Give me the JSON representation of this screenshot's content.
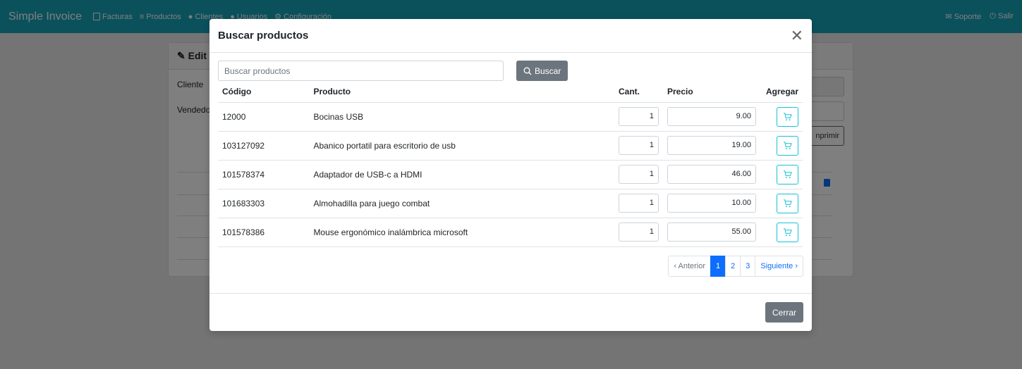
{
  "navbar": {
    "brand": "Simple Invoice",
    "links": [
      "Facturas",
      "Productos",
      "Clientes",
      "Usuarios",
      "Configuración"
    ],
    "right": [
      "Soporte",
      "Salir"
    ]
  },
  "background": {
    "panel_title": "Edit",
    "labels": [
      "Cliente",
      "Vendedo"
    ],
    "print_button": "nprimir"
  },
  "modal": {
    "title": "Buscar productos",
    "search_placeholder": "Buscar productos",
    "search_button": "Buscar",
    "columns": [
      "Código",
      "Producto",
      "Cant.",
      "Precio",
      "Agregar"
    ],
    "rows": [
      {
        "code": "12000",
        "product": "Bocinas USB",
        "qty": "1",
        "price": "9.00"
      },
      {
        "code": "103127092",
        "product": "Abanico portatil para escritorio de usb",
        "qty": "1",
        "price": "19.00"
      },
      {
        "code": "101578374",
        "product": "Adaptador de USB-c a HDMI",
        "qty": "1",
        "price": "46.00"
      },
      {
        "code": "101683303",
        "product": "Almohadilla para juego combat",
        "qty": "1",
        "price": "10.00"
      },
      {
        "code": "101578386",
        "product": "Mouse ergonómico inalámbrica microsoft",
        "qty": "1",
        "price": "55.00"
      }
    ],
    "pagination": {
      "prev": "‹ Anterior",
      "pages": [
        "1",
        "2",
        "3"
      ],
      "next": "Siguiente ›"
    },
    "close_button": "Cerrar"
  },
  "colors": {
    "navbar": "#17a2b8",
    "primary": "#0d6efd",
    "secondary": "#6c757d",
    "info": "#17c1d6"
  }
}
